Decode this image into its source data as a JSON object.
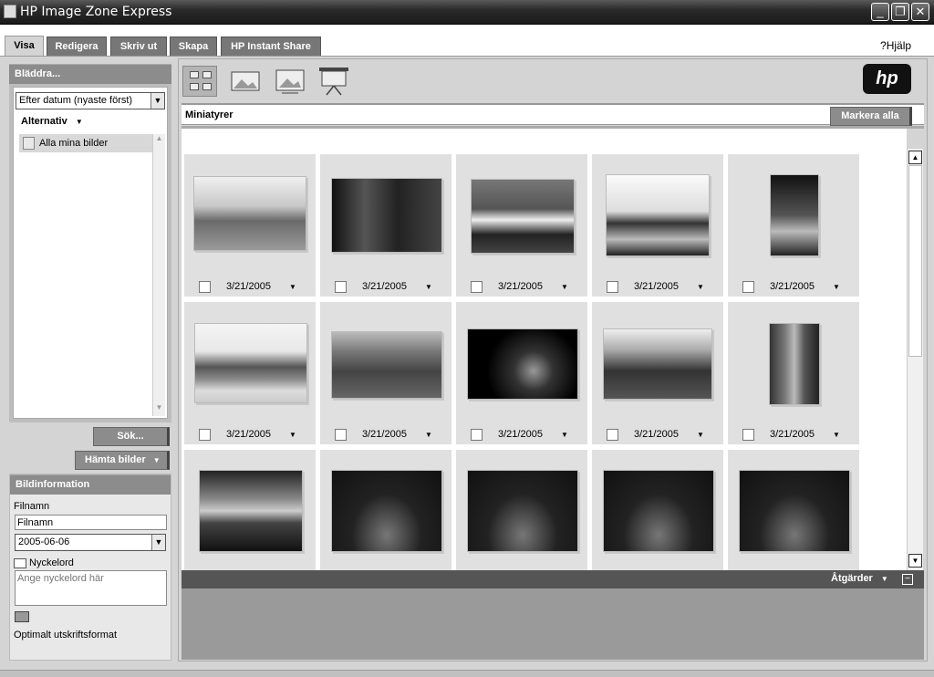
{
  "window": {
    "title": "HP Image Zone Express"
  },
  "tabs": [
    {
      "label": "Visa",
      "active": true
    },
    {
      "label": "Redigera"
    },
    {
      "label": "Skriv ut"
    },
    {
      "label": "Skapa"
    },
    {
      "label": "HP Instant Share"
    }
  ],
  "help": {
    "label": "Hjälp"
  },
  "browse": {
    "header": "Bläddra...",
    "sort_value": "Efter datum (nyaste först)",
    "options_label": "Alternativ",
    "items": [
      {
        "label": "Alla mina bilder"
      }
    ],
    "search_button": "Sök...",
    "fetch_button": "Hämta bilder"
  },
  "info": {
    "header": "Bildinformation",
    "filename_label": "Filnamn",
    "filename_value": "Filnamn",
    "date_value": "2005-06-06",
    "keyword_label": "Nyckelord",
    "keyword_placeholder": "Ange nyckelord här",
    "print_label": "Optimalt utskriftsformat"
  },
  "thumbnails": {
    "header": "Miniatyrer",
    "select_all": "Markera alla",
    "date_label": "3/21/2005",
    "actions_label": "Åtgärder",
    "logo": "hp"
  },
  "colors": {
    "accent": "#8c8c8c",
    "titlebar": "#2b2b2b"
  }
}
